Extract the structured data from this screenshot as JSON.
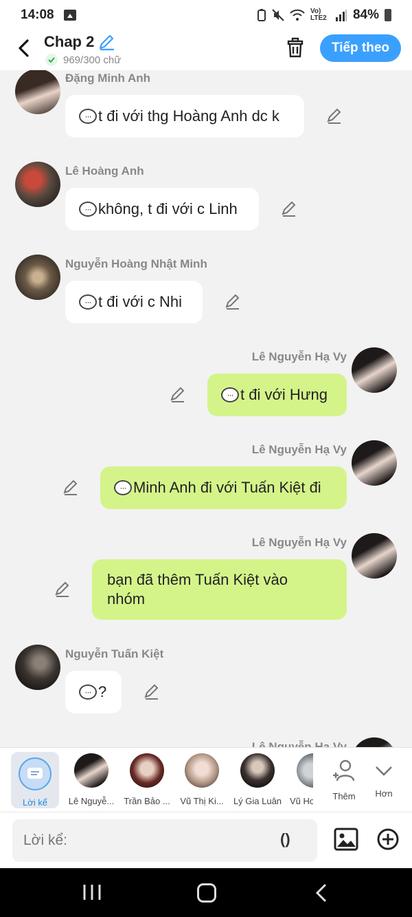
{
  "status": {
    "time": "14:08",
    "network": "Vo) LTE2",
    "battery": "84%"
  },
  "header": {
    "title": "Chap 2",
    "word_count": "969/300 chữ",
    "next_label": "Tiếp theo"
  },
  "messages": [
    {
      "sender": "Đặng Minh Anh",
      "text": "t đi với thg Hoàng Anh dc k",
      "side": "left"
    },
    {
      "sender": "Lê Hoàng Anh",
      "text": "không, t đi với c Linh",
      "side": "left"
    },
    {
      "sender": "Nguyễn Hoàng Nhật Minh",
      "text": "t đi với c Nhi",
      "side": "left"
    },
    {
      "sender": "Lê Nguyễn Hạ Vy",
      "text": "t đi với Hưng",
      "side": "right"
    },
    {
      "sender": "Lê Nguyễn Hạ Vy",
      "text": "Minh Anh đi với Tuấn Kiệt đi",
      "side": "right"
    },
    {
      "sender": "Lê Nguyễn Hạ Vy",
      "text_line1": "bạn đã thêm Tuấn Kiệt vào",
      "text_line2": "nhóm",
      "side": "right"
    },
    {
      "sender": "Nguyễn Tuấn Kiệt",
      "text": "?",
      "side": "left"
    },
    {
      "sender": "Lê Nguyễn Hạ Vy",
      "side": "right"
    }
  ],
  "characters": [
    {
      "label": "Lời kể"
    },
    {
      "label": "Lê Nguyễ..."
    },
    {
      "label": "Trần Bảo ..."
    },
    {
      "label": "Vũ Thị Ki..."
    },
    {
      "label": "Lý Gia Luân"
    },
    {
      "label": "Vũ Ho"
    },
    {
      "label": "Thêm"
    },
    {
      "label": "Hơn"
    }
  ],
  "input": {
    "placeholder": "Lời kể:",
    "paren": "()"
  },
  "colors": {
    "accent": "#3aa0ff",
    "out_bubble": "#d4f48a",
    "in_bubble": "#ffffff",
    "background": "#f2f2f2"
  }
}
